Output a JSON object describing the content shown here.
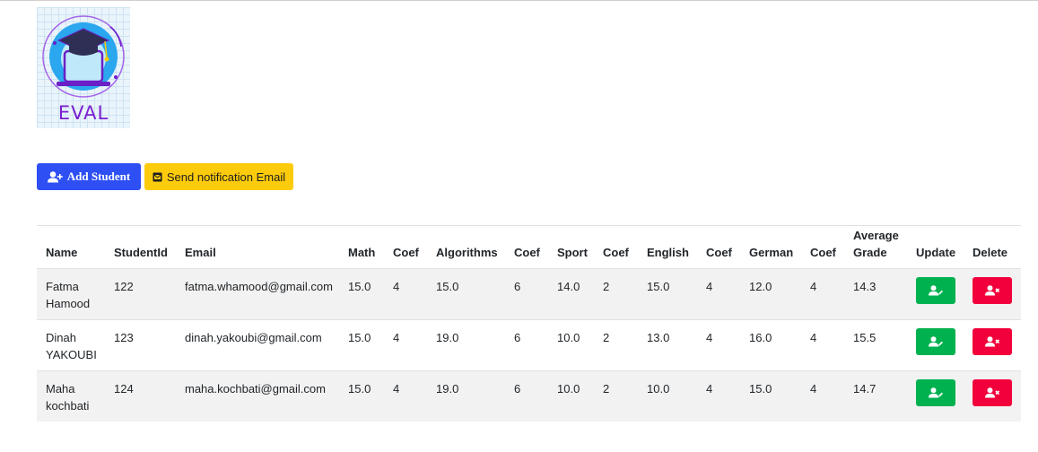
{
  "logo": {
    "text": "EVAL",
    "icon": "graduation-laptop-logo"
  },
  "toolbar": {
    "add_label": "Add Student",
    "add_icon": "user-plus-icon",
    "email_label": "Send notification Email",
    "email_icon": "envelope-icon"
  },
  "table": {
    "headers": {
      "name": "Name",
      "student_id": "StudentId",
      "email": "Email",
      "math": "Math",
      "coef1": "Coef",
      "algorithms": "Algorithms",
      "coef2": "Coef",
      "sport": "Sport",
      "coef3": "Coef",
      "english": "English",
      "coef4": "Coef",
      "german": "German",
      "coef5": "Coef",
      "avg_line1": "Average",
      "avg_line2": "Grade",
      "update": "Update",
      "delete": "Delete"
    },
    "rows": [
      {
        "first": "Fatma",
        "last": "Hamood",
        "id": "122",
        "email": "fatma.whamood@gmail.com",
        "math": "15.0",
        "math_coef": "4",
        "algo": "15.0",
        "algo_coef": "6",
        "sport": "14.0",
        "sport_coef": "2",
        "english": "15.0",
        "english_coef": "4",
        "german": "12.0",
        "german_coef": "4",
        "avg": "14.3"
      },
      {
        "first": "Dinah",
        "last": "YAKOUBI",
        "id": "123",
        "email": "dinah.yakoubi@gmail.com",
        "math": "15.0",
        "math_coef": "4",
        "algo": "19.0",
        "algo_coef": "6",
        "sport": "10.0",
        "sport_coef": "2",
        "english": "13.0",
        "english_coef": "4",
        "german": "16.0",
        "german_coef": "4",
        "avg": "15.5"
      },
      {
        "first": "Maha",
        "last": "kochbati",
        "id": "124",
        "email": "maha.kochbati@gmail.com",
        "math": "15.0",
        "math_coef": "4",
        "algo": "19.0",
        "algo_coef": "6",
        "sport": "10.0",
        "sport_coef": "2",
        "english": "10.0",
        "english_coef": "4",
        "german": "15.0",
        "german_coef": "4",
        "avg": "14.7"
      }
    ]
  },
  "colors": {
    "add_button": "#2e4ff3",
    "email_button": "#fccb0c",
    "update_button": "#00b14f",
    "delete_button": "#f2003c"
  }
}
